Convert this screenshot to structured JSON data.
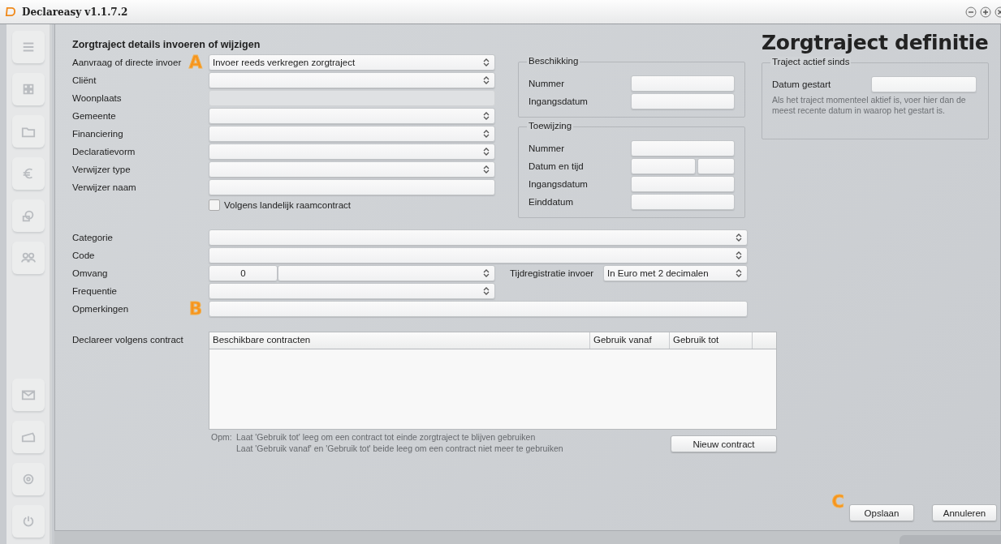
{
  "window": {
    "title": "Declareasy v1.1.7.2"
  },
  "form": {
    "heading": "Zorgtraject details invoeren of wijzigen",
    "rows": [
      {
        "label": "Aanvraag of directe invoer",
        "kind": "select",
        "value": "Invoer reeds verkregen zorgtraject",
        "marker": "A"
      },
      {
        "label": "Cliënt",
        "kind": "select"
      },
      {
        "label": "Woonplaats",
        "kind": "readonly"
      },
      {
        "label": "Gemeente",
        "kind": "select"
      },
      {
        "label": "Financiering",
        "kind": "select"
      },
      {
        "label": "Declaratievorm",
        "kind": "select"
      },
      {
        "label": "Verwijzer type",
        "kind": "select"
      },
      {
        "label": "Verwijzer naam",
        "kind": "text"
      }
    ],
    "checkbox": {
      "label": "Volgens landelijk raamcontract",
      "checked": false
    }
  },
  "beschikking": {
    "title": "Beschikking",
    "rows": [
      {
        "label": "Nummer",
        "kind": "text"
      },
      {
        "label": "Ingangsdatum",
        "kind": "text"
      }
    ]
  },
  "toewijzing": {
    "title": "Toewijzing",
    "rows": [
      {
        "label": "Nummer",
        "kind": "text"
      },
      {
        "label": "Datum en tijd",
        "kind": "datetime"
      },
      {
        "label": "Ingangsdatum",
        "kind": "text"
      },
      {
        "label": "Einddatum",
        "kind": "text"
      }
    ]
  },
  "page_title": "Zorgtraject definitie",
  "traject": {
    "title": "Traject actief sinds",
    "rows": [
      {
        "label": "Datum gestart",
        "kind": "text"
      }
    ],
    "hint": "Als het traject momenteel aktief is, voer hier dan de meest recente datum in waarop het gestart is."
  },
  "details": {
    "rows": [
      {
        "label": "Categorie",
        "kind": "select"
      },
      {
        "label": "Code",
        "kind": "select"
      },
      {
        "label": "Omvang",
        "kind": "amount",
        "value": "0",
        "extra": {
          "label": "Tijdregistratie invoer",
          "value": "In Euro met 2 decimalen"
        }
      },
      {
        "label": "Frequentie",
        "kind": "select"
      },
      {
        "label": "Opmerkingen",
        "kind": "text",
        "marker": "B"
      }
    ]
  },
  "contract": {
    "label": "Declareer volgens contract",
    "columns": [
      "Beschikbare contracten",
      "Gebruik vanaf",
      "Gebruik tot"
    ],
    "note_prefix": "Opm:",
    "notes": [
      "Laat 'Gebruik tot' leeg om een contract tot einde zorgtraject te blijven gebruiken",
      "Laat 'Gebruik vanaf' en 'Gebruik tot' beide leeg om een contract niet meer te gebruiken"
    ],
    "new_button": "Nieuw contract"
  },
  "footer": {
    "marker": "C",
    "buttons": [
      "Opslaan",
      "Annuleren"
    ]
  }
}
